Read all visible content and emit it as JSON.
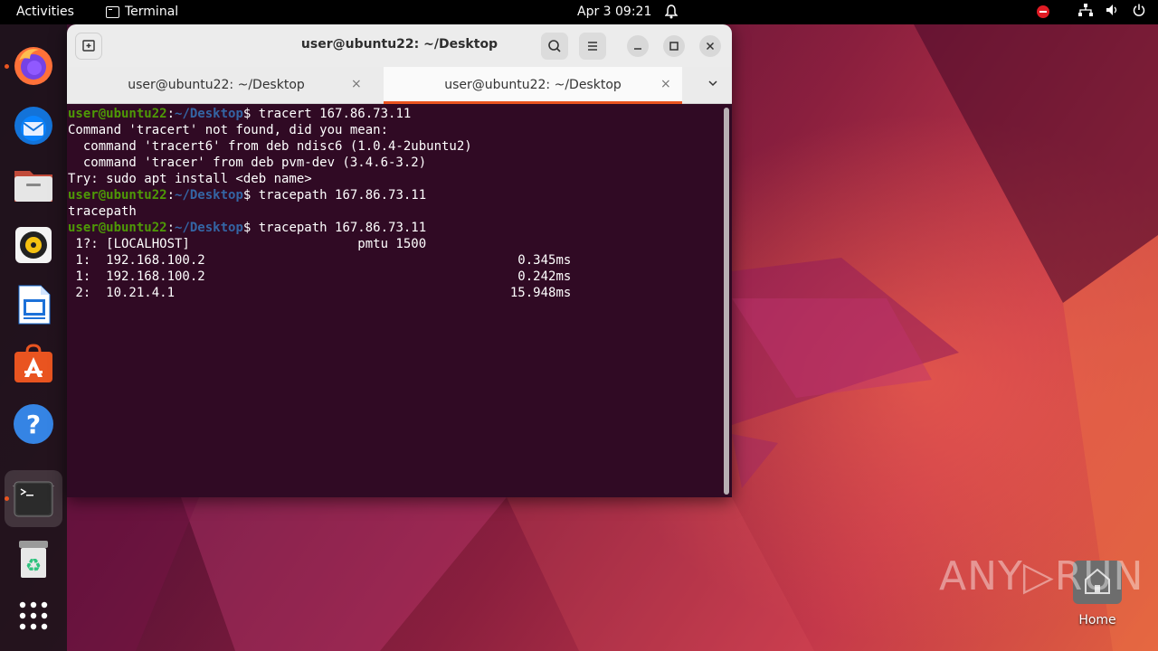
{
  "topbar": {
    "activities": "Activities",
    "app_name": "Terminal",
    "clock": "Apr 3  09:21"
  },
  "dock": {
    "items": [
      {
        "name": "firefox",
        "icon": "firefox-icon",
        "running": true
      },
      {
        "name": "thunderbird",
        "icon": "thunderbird-icon",
        "running": false
      },
      {
        "name": "files",
        "icon": "files-icon",
        "running": false
      },
      {
        "name": "rhythmbox",
        "icon": "rhythmbox-icon",
        "running": false
      },
      {
        "name": "libreoffice-writer",
        "icon": "writer-icon",
        "running": false
      },
      {
        "name": "app-center",
        "icon": "app-center-icon",
        "running": false
      },
      {
        "name": "help",
        "icon": "help-icon",
        "running": false
      },
      {
        "name": "terminal",
        "icon": "terminal-icon",
        "running": true
      },
      {
        "name": "trash",
        "icon": "trash-icon",
        "running": false
      },
      {
        "name": "show-apps",
        "icon": "app-grid-icon",
        "running": false
      }
    ]
  },
  "window": {
    "title": "user@ubuntu22: ~/Desktop",
    "tabs": [
      {
        "label": "user@ubuntu22: ~/Desktop",
        "active": false
      },
      {
        "label": "user@ubuntu22: ~/Desktop",
        "active": true
      }
    ],
    "close_glyph": "×"
  },
  "terminal": {
    "prompt_user": "user@ubuntu22",
    "prompt_sep": ":",
    "prompt_path": "~/Desktop",
    "prompt_end": "$ ",
    "lines": [
      {
        "prompt": true,
        "text": "tracert 167.86.73.11"
      },
      {
        "prompt": false,
        "text": "Command 'tracert' not found, did you mean:"
      },
      {
        "prompt": false,
        "text": "  command 'tracert6' from deb ndisc6 (1.0.4-2ubuntu2)"
      },
      {
        "prompt": false,
        "text": "  command 'tracer' from deb pvm-dev (3.4.6-3.2)"
      },
      {
        "prompt": false,
        "text": "Try: sudo apt install <deb name>"
      },
      {
        "prompt": true,
        "text": "tracepath 167.86.73.11"
      },
      {
        "prompt": false,
        "text": "tracepath"
      },
      {
        "prompt": true,
        "text": "tracepath 167.86.73.11"
      },
      {
        "prompt": false,
        "text": " 1?: [LOCALHOST]                      pmtu 1500"
      },
      {
        "prompt": false,
        "text": " 1:  192.168.100.2                                         0.345ms"
      },
      {
        "prompt": false,
        "text": " 1:  192.168.100.2                                         0.242ms"
      },
      {
        "prompt": false,
        "text": " 2:  10.21.4.1                                            15.948ms"
      }
    ]
  },
  "desktop": {
    "home_label": "Home",
    "watermark": "ANY▷RUN"
  },
  "colors": {
    "accent": "#e95420",
    "terminal_bg": "#300a24",
    "prompt_user": "#4e9a06",
    "prompt_path": "#3465a4"
  }
}
